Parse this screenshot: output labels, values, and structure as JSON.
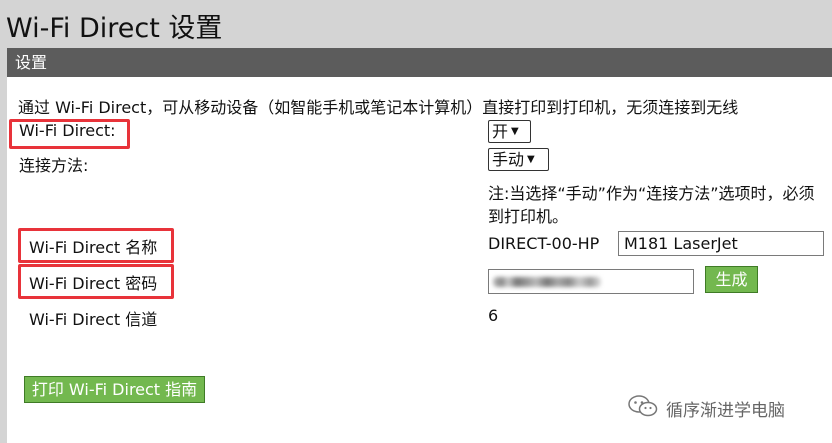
{
  "page": {
    "title": "Wi-Fi Direct 设置"
  },
  "section": {
    "title": "设置"
  },
  "intro": "通过 Wi-Fi Direct，可从移动设备（如智能手机或笔记本计算机）直接打印到打印机，无须连接到无线",
  "fields": {
    "wifi_direct": {
      "label": "Wi-Fi Direct:",
      "value": "开"
    },
    "connection_method": {
      "label": "连接方法:",
      "value": "手动"
    },
    "note_line1": "注:当选择“手动”作为“连接方法”选项时，必须",
    "note_line2": "到打印机。",
    "name": {
      "label": "Wi-Fi Direct 名称",
      "prefix": "DIRECT-00-HP",
      "value": "M181 LaserJet"
    },
    "password": {
      "label": "Wi-Fi Direct 密码",
      "generate_label": "生成"
    },
    "channel": {
      "label": "Wi-Fi Direct 信道",
      "value": "6"
    }
  },
  "print_guide_button": "打印 Wi-Fi Direct 指南",
  "watermark": {
    "text": "循序渐进学电脑",
    "icon": "wechat-icon"
  },
  "colors": {
    "highlight": "#e8333a",
    "accent_green": "#73b84f",
    "header_bar": "#5c5c5c"
  }
}
